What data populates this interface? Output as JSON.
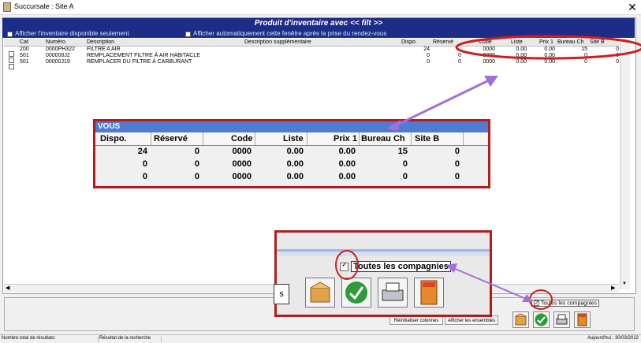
{
  "window": {
    "title": "Succursale : Site A",
    "close": "✕"
  },
  "banner": {
    "title": "Produit d'inventaire avec << filt >>"
  },
  "options": {
    "show_available": "Afficher l'inventaire disponible seulement",
    "show_after_appointment": "Afficher automatiquement cette fenêtre après la prise du rendez-vous"
  },
  "grid": {
    "columns": [
      "Cat",
      "Numéro",
      "Description",
      "Description supplémentaire",
      "Dispo.",
      "Réservé",
      "Code",
      "Liste",
      "Prix 1",
      "Bureau Ch",
      "Site B"
    ],
    "rows": [
      [
        "200",
        "0000PH322",
        "FILTRE A AIR",
        "",
        "24",
        "",
        "0000",
        "0.00",
        "0.00",
        "15",
        "0"
      ],
      [
        "501",
        "000000J2",
        "REMPLACEMENT FILTRE À AIR HABITACLE",
        "",
        "0",
        "0",
        "0000",
        "0.00",
        "0.00",
        "0",
        "0"
      ],
      [
        "501",
        "00000J19",
        "REMPLACER DU FILTRE À CARBURANT",
        "",
        "0",
        "0",
        "0000",
        "0.00",
        "0.00",
        "0",
        "0"
      ]
    ]
  },
  "zoom1": {
    "header": "VOUS",
    "columns": [
      "Dispo.",
      "Réservé",
      "Code",
      "Liste",
      "Prix 1",
      "Bureau Ch",
      "Site B"
    ],
    "rows": [
      [
        "24",
        "0",
        "0000",
        "0.00",
        "0.00",
        "15",
        "0"
      ],
      [
        "0",
        "0",
        "0000",
        "0.00",
        "0.00",
        "0",
        "0"
      ],
      [
        "0",
        "0",
        "0000",
        "0.00",
        "0.00",
        "0",
        "0"
      ]
    ]
  },
  "zoom2": {
    "all_companies": "Toutes les compagnies",
    "partial_label": "s"
  },
  "bottom": {
    "all_companies": "Toutes les compagnies",
    "reset_columns": "Réinitialiser colonnes",
    "show_all": "Afficher les ensembles"
  },
  "status": {
    "total_results": "Nombre total de résultats:",
    "search_result": "Résultat de la recherche",
    "today": "Aujourd'hui : 30/03/2022"
  },
  "icons": [
    "box-icon",
    "check-icon",
    "printer-icon",
    "exit-icon"
  ],
  "colors": {
    "banner": "#1d2c87",
    "header_blue": "#4f7bd2",
    "annotation_red": "#b41c1c",
    "annotation_purple": "#a070d8"
  }
}
